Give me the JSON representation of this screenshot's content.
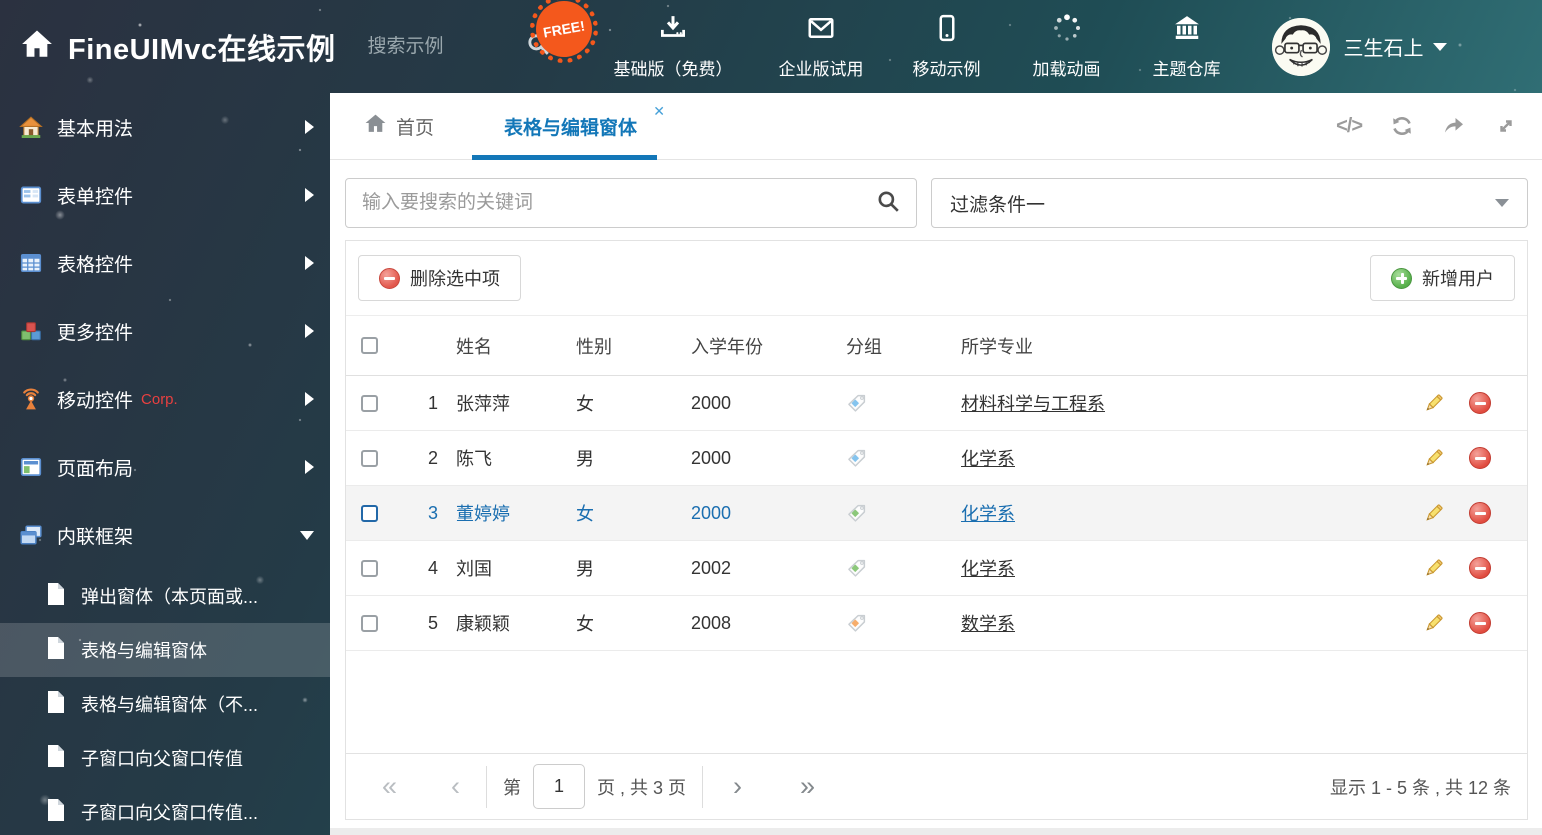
{
  "app": {
    "title": "FineUIMvc在线示例"
  },
  "header": {
    "search_placeholder": "搜索示例",
    "free_badge": "FREE!",
    "nav": [
      {
        "label": "基础版（免费）"
      },
      {
        "label": "企业版试用"
      },
      {
        "label": "移动示例"
      },
      {
        "label": "加载动画"
      },
      {
        "label": "主题仓库"
      }
    ],
    "username": "三生石上"
  },
  "sidebar": {
    "items": [
      {
        "label": "基本用法"
      },
      {
        "label": "表单控件"
      },
      {
        "label": "表格控件"
      },
      {
        "label": "更多控件"
      },
      {
        "label": "移动控件",
        "badge": "Corp."
      },
      {
        "label": "页面布局"
      },
      {
        "label": "内联框架"
      }
    ],
    "subitems": [
      {
        "label": "弹出窗体（本页面或..."
      },
      {
        "label": "表格与编辑窗体",
        "selected": true
      },
      {
        "label": "表格与编辑窗体（不..."
      },
      {
        "label": "子窗口向父窗口传值"
      },
      {
        "label": "子窗口向父窗口传值..."
      }
    ]
  },
  "tabs": {
    "home": "首页",
    "active": "表格与编辑窗体"
  },
  "icons": {
    "close_glyph": "✕",
    "code_glyph": "</>"
  },
  "filters": {
    "search_placeholder": "输入要搜索的关键词",
    "dropdown_value": "过滤条件一"
  },
  "toolbar": {
    "delete_label": "删除选中项",
    "add_label": "新增用户"
  },
  "table": {
    "headers": [
      "姓名",
      "性别",
      "入学年份",
      "分组",
      "所学专业"
    ],
    "rows": [
      {
        "num": "1",
        "name": "张萍萍",
        "gender": "女",
        "year": "2000",
        "tag": "blue",
        "major": "材料科学与工程系",
        "selected": false
      },
      {
        "num": "2",
        "name": "陈飞",
        "gender": "男",
        "year": "2000",
        "tag": "blue",
        "major": "化学系",
        "selected": false
      },
      {
        "num": "3",
        "name": "董婷婷",
        "gender": "女",
        "year": "2000",
        "tag": "green",
        "major": "化学系",
        "selected": true
      },
      {
        "num": "4",
        "name": "刘国",
        "gender": "男",
        "year": "2002",
        "tag": "green",
        "major": "化学系",
        "selected": false
      },
      {
        "num": "5",
        "name": "康颖颖",
        "gender": "女",
        "year": "2008",
        "tag": "orange",
        "major": "数学系",
        "selected": false
      }
    ]
  },
  "pagination": {
    "first_glyph": "«",
    "prev_glyph": "‹",
    "page_label": "第",
    "page_value": "1",
    "total_label": "页 , 共 3 页",
    "next_glyph": "›",
    "last_glyph": "»",
    "summary": "显示 1 - 5 条 , 共 12 条"
  },
  "colors": {
    "accent": "#1377b8",
    "free_badge": "#f4581c",
    "tag_blue": "#85c4ee",
    "tag_green": "#8cc87b",
    "tag_orange": "#f6ad6b",
    "danger": "#e2574c",
    "success": "#57b04a"
  }
}
